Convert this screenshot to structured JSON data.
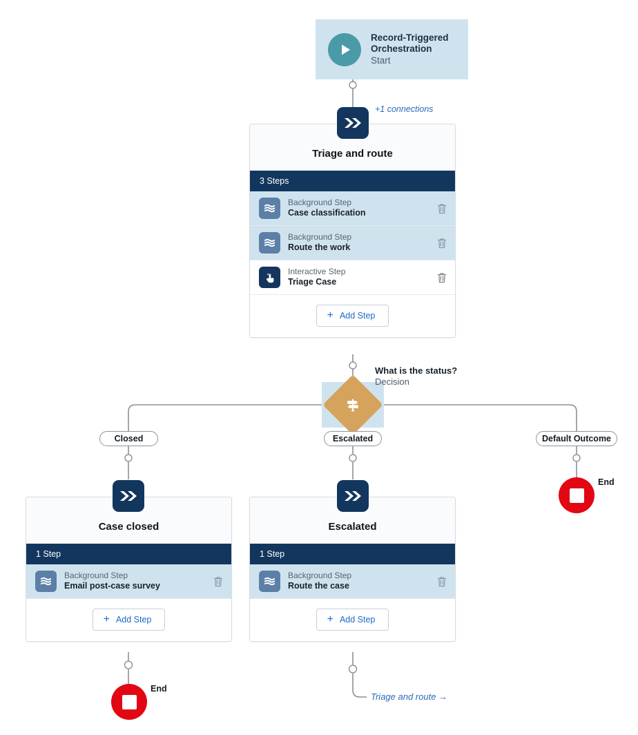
{
  "start": {
    "title": "Record-Triggered Orchestration",
    "subtitle": "Start",
    "icon": "play-icon"
  },
  "connections_note": "+1 connections",
  "stages": [
    {
      "id": "triage",
      "title": "Triage and route",
      "steps_label": "3 Steps",
      "add_step_label": "Add Step",
      "steps": [
        {
          "kind": "Background Step",
          "name": "Case classification",
          "icon": "background-step-icon",
          "highlighted": true
        },
        {
          "kind": "Background Step",
          "name": "Route the work",
          "icon": "background-step-icon",
          "highlighted": true
        },
        {
          "kind": "Interactive Step",
          "name": "Triage Case",
          "icon": "interactive-step-icon",
          "highlighted": false
        }
      ]
    },
    {
      "id": "case-closed",
      "title": "Case closed",
      "steps_label": "1 Step",
      "add_step_label": "Add Step",
      "steps": [
        {
          "kind": "Background Step",
          "name": "Email post-case survey",
          "icon": "background-step-icon",
          "highlighted": true
        }
      ]
    },
    {
      "id": "escalated",
      "title": "Escalated",
      "steps_label": "1 Step",
      "add_step_label": "Add Step",
      "steps": [
        {
          "kind": "Background Step",
          "name": "Route the case",
          "icon": "background-step-icon",
          "highlighted": true
        }
      ]
    }
  ],
  "decision": {
    "title": "What is the status?",
    "subtitle": "Decision",
    "icon": "signpost-icon",
    "outcomes": [
      "Closed",
      "Escalated",
      "Default Outcome"
    ]
  },
  "end_nodes": [
    {
      "label": "End"
    },
    {
      "label": "End"
    }
  ],
  "jump_link": "Triage and route →",
  "colors": {
    "navy": "#13365e",
    "teal": "#4b9aa8",
    "highlight_blue": "#cfe3ef",
    "step_icon_blue": "#5b7fa6",
    "decision_gold": "#d6a35c",
    "end_red": "#e30613",
    "link_blue": "#2a6bb8"
  }
}
